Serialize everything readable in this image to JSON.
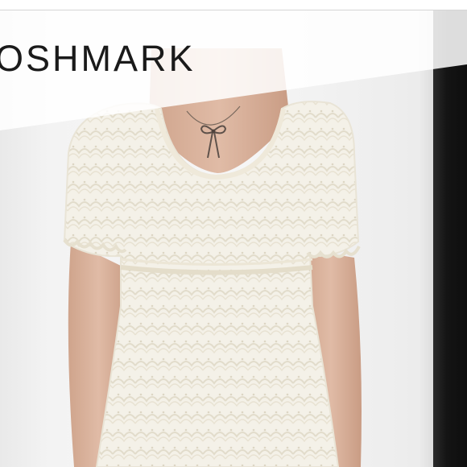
{
  "brand": {
    "wordmark": "OSHMARK"
  },
  "listing_image": {
    "subject": "cream-lace-short-sleeve-dress"
  },
  "colors": {
    "banner": "#ffffff",
    "wordmark": "#1a1a1a",
    "lace": "#f4f1e8",
    "skin": "#d9b29b",
    "right_edge": "#111111"
  },
  "icons": [
    "bow-pendant-icon"
  ]
}
